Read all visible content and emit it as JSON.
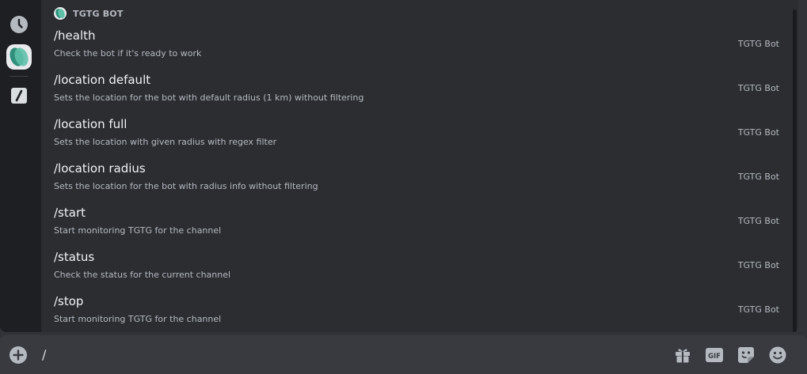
{
  "autocomplete": {
    "section_title": "TGTG BOT",
    "commands": [
      {
        "name": "/health",
        "description": "Check the bot if it's ready to work",
        "source": "TGTG Bot"
      },
      {
        "name": "/location default",
        "description": "Sets the location for the bot with default radius (1 km) without filtering",
        "source": "TGTG Bot"
      },
      {
        "name": "/location full",
        "description": "Sets the location with given radius with regex filter",
        "source": "TGTG Bot"
      },
      {
        "name": "/location radius",
        "description": "Sets the location for the bot with radius info without filtering",
        "source": "TGTG Bot"
      },
      {
        "name": "/start",
        "description": "Start monitoring TGTG for the channel",
        "source": "TGTG Bot"
      },
      {
        "name": "/status",
        "description": "Check the status for the current channel",
        "source": "TGTG Bot"
      },
      {
        "name": "/stop",
        "description": "Start monitoring TGTG for the channel",
        "source": "TGTG Bot"
      }
    ]
  },
  "rail": {
    "icons": [
      "clock-icon",
      "tgtg-bot-avatar",
      "slash-command-icon"
    ]
  },
  "input": {
    "value": "/",
    "tools": [
      "gift-icon",
      "gif-icon",
      "sticker-icon",
      "emoji-icon"
    ]
  },
  "colors": {
    "background": "#313338",
    "popup": "#2b2d31",
    "rail": "#1e1f22",
    "input_bar": "#383a40",
    "text_primary": "#f2f3f5",
    "text_muted": "#b5bac1",
    "bot_teal": "#3fa48c"
  }
}
